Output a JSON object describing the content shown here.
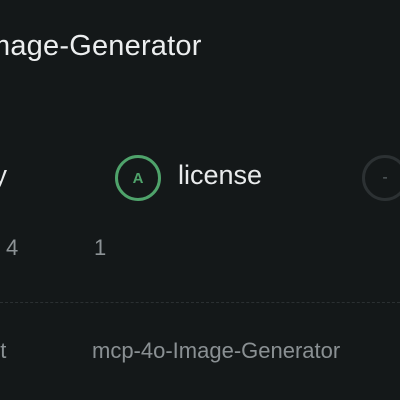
{
  "header": {
    "title": "mage-Generator"
  },
  "badges": {
    "left_label": "ty",
    "license_grade": "A",
    "license_label": "license",
    "next_grade": "-"
  },
  "counts": {
    "left": "4",
    "right": "1"
  },
  "footer": {
    "left_text": "ot",
    "right_text": "mcp-4o-Image-Generator"
  },
  "colors": {
    "background": "#141819",
    "grade_a": "#4fa36b",
    "muted_text": "#8a9093"
  }
}
